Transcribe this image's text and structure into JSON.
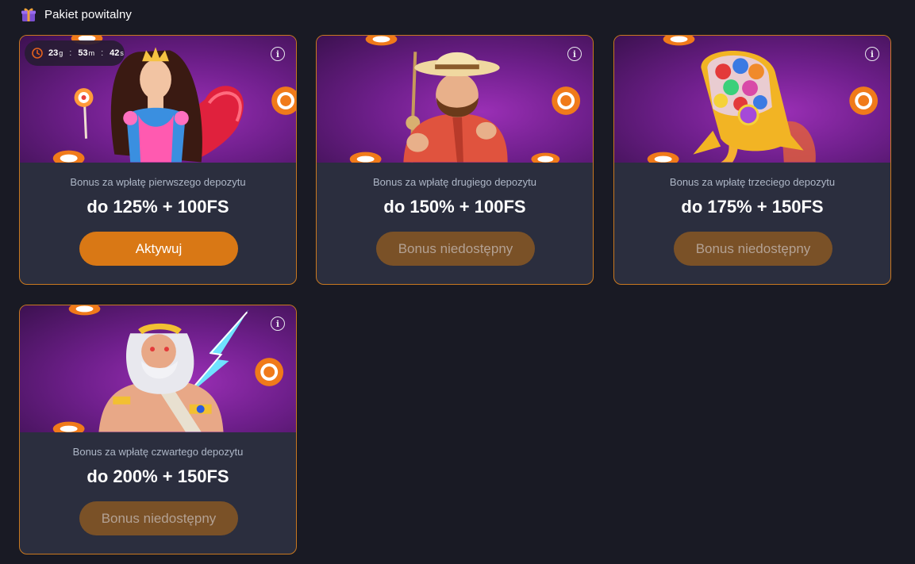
{
  "header": {
    "title": "Pakiet powitalny",
    "icon": "gift-icon"
  },
  "timer": {
    "days": "23",
    "days_unit": "g",
    "hours": "53",
    "hours_unit": "m",
    "seconds": "42",
    "seconds_unit": "s",
    "separator": ":"
  },
  "cards": [
    {
      "subtitle": "Bonus za wpłatę pierwszego depozytu",
      "amount": "do 125% + 100FS",
      "button": "Aktywuj",
      "state": "active",
      "art": "princess-candy"
    },
    {
      "subtitle": "Bonus za wpłatę drugiego depozytu",
      "amount": "do 150% + 100FS",
      "button": "Bonus niedostępny",
      "state": "unavailable",
      "art": "fisherman"
    },
    {
      "subtitle": "Bonus za wpłatę trzeciego depozytu",
      "amount": "do 175% + 150FS",
      "button": "Bonus niedostępny",
      "state": "unavailable",
      "art": "candy-rocket"
    },
    {
      "subtitle": "Bonus za wpłatę czwartego depozytu",
      "amount": "do 200% + 150FS",
      "button": "Bonus niedostępny",
      "state": "unavailable",
      "art": "zeus-lightning"
    }
  ],
  "colors": {
    "background": "#191a24",
    "card": "#2b2e3e",
    "card_border": "#c9781f",
    "button_active": "#d97815",
    "button_disabled": "#7a5127",
    "banner_purple": "#8a2aa6"
  }
}
